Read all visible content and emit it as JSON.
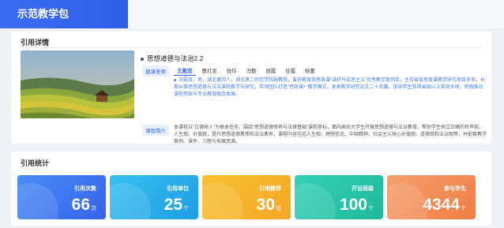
{
  "header": {
    "title": "示范教学包"
  },
  "detail": {
    "section_title": "引用详情",
    "course_name": "思想道德与法治2.2",
    "teacher_label": "建课老师",
    "teachers": [
      "王殿双",
      "曹打发",
      "张玲",
      "冯勤",
      "胡霞",
      "甘霞",
      "桂蒙"
    ],
    "active_teacher_index": 0,
    "bio": "王殿双，男，湖北黄冈人，湖北第二师范学院副教授，曾获教育部思政课“讲好马克思主义”优秀教学案例奖，主持省级思政课教学研究项目多项，长期从事思想道德与法治课程教学与研究，带领团队打造“思政课+”教学模式，发表教学研究论文二十余篇，指导学生获得省级以上奖项多项，积极推动课程思政与专业教育融合发展。",
    "intro_label": "课程简介",
    "intro": "本课程以“立德树人”为根本任务，围绕“思想道德修养与法律基础”课程目标，面向高校大学生开展思想道德与法治教育，帮助学生树立正确的世界观、人生观、价值观，提升思想道德素质和法治素养，课程内容包括人生观、理想信念、中国精神、社会主义核心价值观、道德观和法治观等，并配套教学案例、课件、习题与拓展资源。"
  },
  "stats": {
    "section_title": "引用统计",
    "cards": [
      {
        "label": "引用次数",
        "value": "66",
        "unit": "次",
        "color_from": "#4a8cf7",
        "color_to": "#3563e9"
      },
      {
        "label": "引用单位",
        "value": "25",
        "unit": "个",
        "color_from": "#37c0f0",
        "color_to": "#1e9de6"
      },
      {
        "label": "引用教师",
        "value": "30",
        "unit": "位",
        "color_from": "#f7c234",
        "color_to": "#f5a623"
      },
      {
        "label": "开设班级",
        "value": "100",
        "unit": "个",
        "color_from": "#34d1b8",
        "color_to": "#1fb89a"
      },
      {
        "label": "参与学生",
        "value": "4344",
        "unit": "个",
        "color_from": "#f5a06e",
        "color_to": "#f07d44"
      }
    ]
  }
}
